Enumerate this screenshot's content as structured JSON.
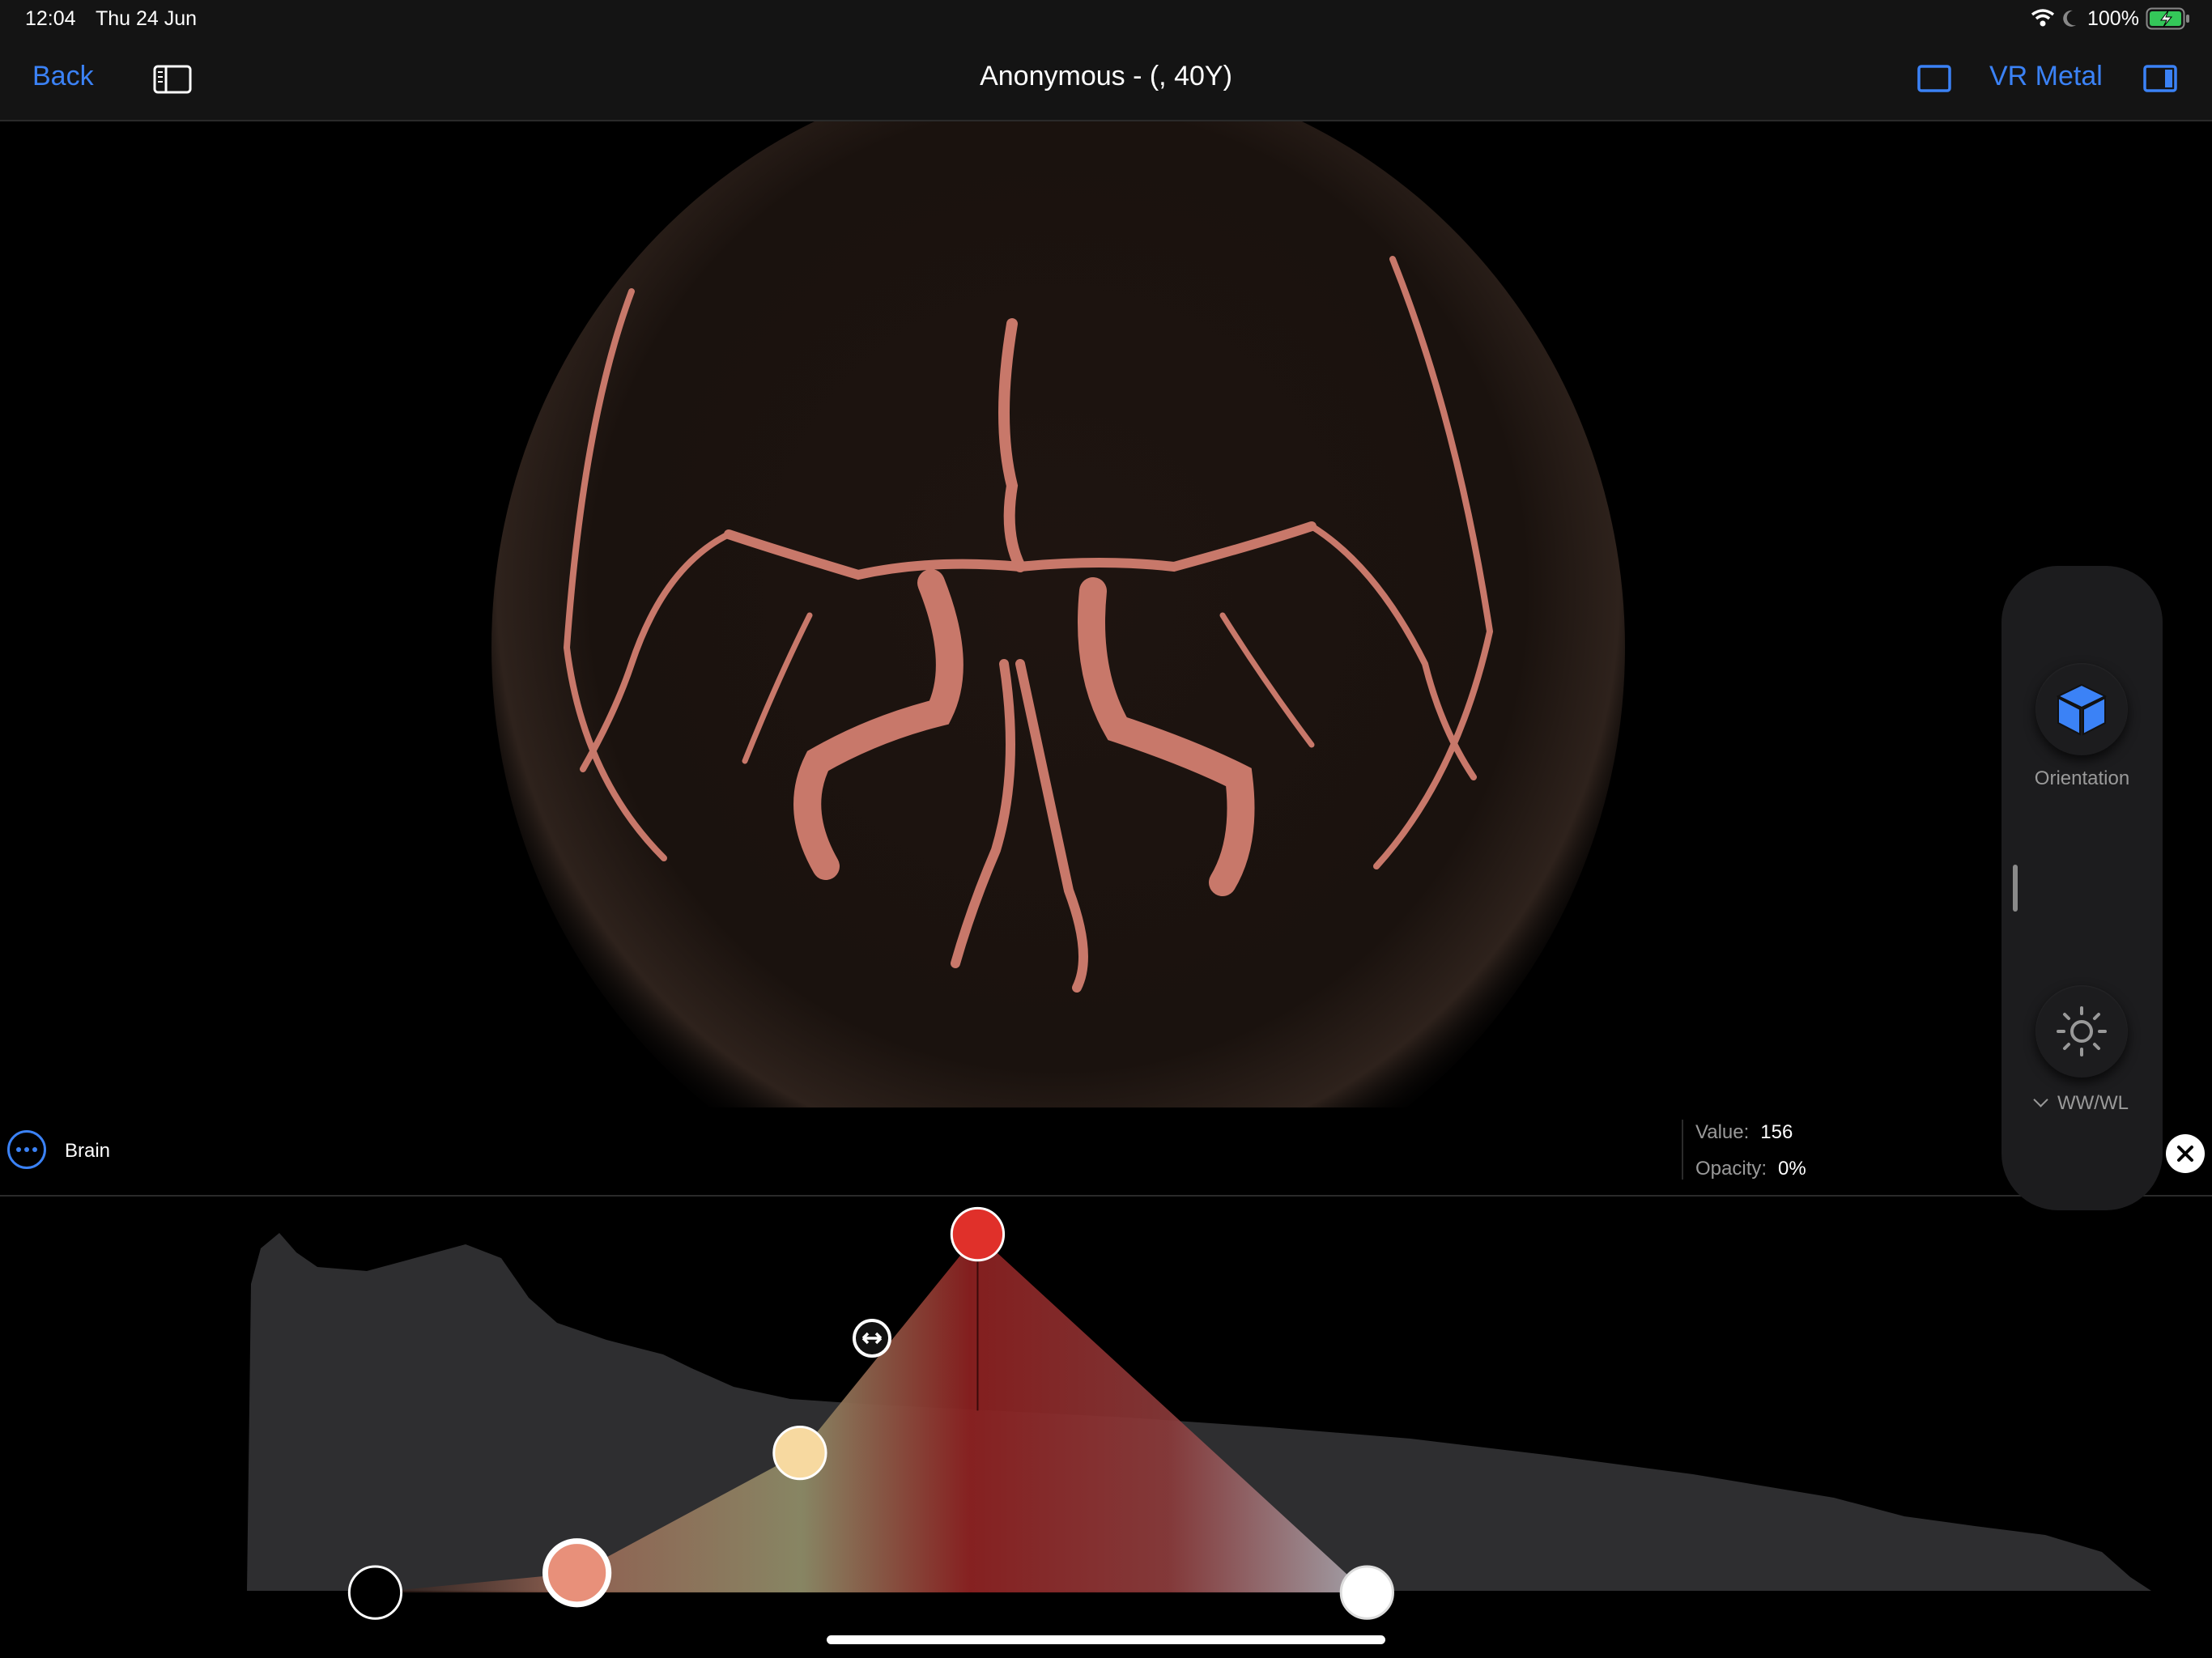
{
  "status_bar": {
    "time": "12:04",
    "date": "Thu 24 Jun",
    "battery": "100%",
    "icons": [
      "wifi-icon",
      "moon-icon",
      "battery-charging-icon"
    ]
  },
  "nav": {
    "back_label": "Back",
    "title": "Anonymous - (, 40Y)",
    "render_mode": "VR Metal",
    "icons": [
      "sidebar-icon",
      "layout-single-icon",
      "sidebar-right-icon"
    ]
  },
  "preset": {
    "name": "Brain",
    "icon": "ellipsis-circle-icon"
  },
  "readout": {
    "value_label": "Value:",
    "value": "156",
    "opacity_label": "Opacity:",
    "opacity": "0%"
  },
  "tool_panel": {
    "orientation_label": "Orientation",
    "orientation_icon": "cube-icon",
    "wwwl_label": "WW/WL",
    "wwwl_icon": "sun-icon"
  },
  "transfer_function": {
    "control_point_colors": [
      "#000000",
      "#e8907a",
      "#f7d9a0",
      "#e0302a",
      "#ffffff"
    ]
  },
  "colors": {
    "accent": "#3b82f6",
    "histogram": "#2e2e30",
    "battery": "#34c759"
  }
}
